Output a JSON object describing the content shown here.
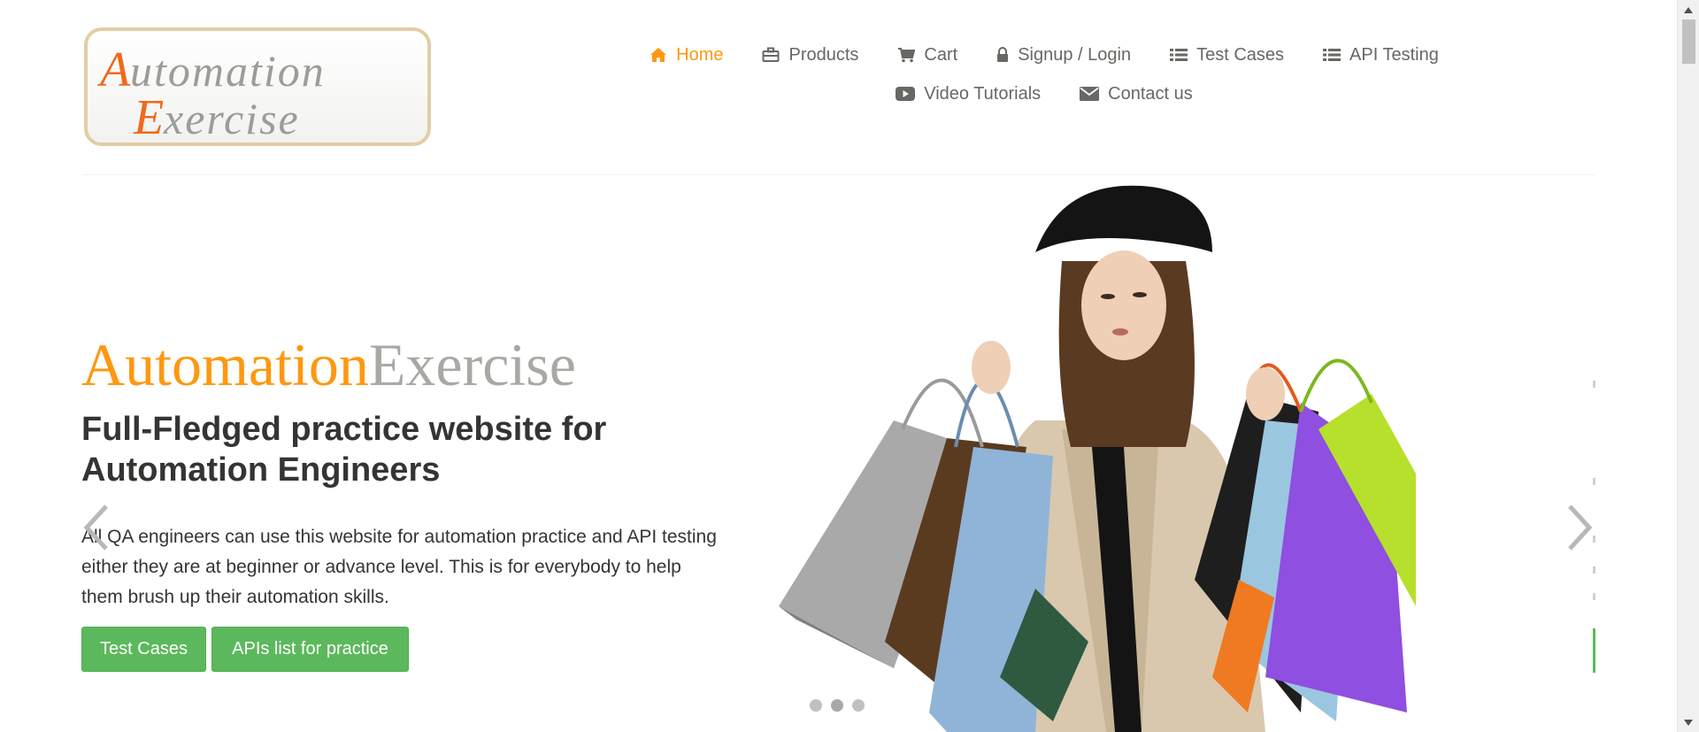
{
  "header": {
    "logo": {
      "line1": "Automation",
      "line2": "Exercise"
    },
    "nav": {
      "row1": [
        {
          "label": "Home",
          "icon": "home-icon",
          "active": true
        },
        {
          "label": "Products",
          "icon": "briefcase-icon",
          "active": false
        },
        {
          "label": "Cart",
          "icon": "cart-icon",
          "active": false
        },
        {
          "label": "Signup / Login",
          "icon": "lock-icon",
          "active": false
        },
        {
          "label": "Test Cases",
          "icon": "list-icon",
          "active": false
        },
        {
          "label": "API Testing",
          "icon": "list-icon",
          "active": false
        }
      ],
      "row2": [
        {
          "label": "Video Tutorials",
          "icon": "youtube-play-icon",
          "active": false
        },
        {
          "label": "Contact us",
          "icon": "envelope-icon",
          "active": false
        }
      ]
    }
  },
  "hero": {
    "brand_orange": "Automation",
    "brand_grey": "Exercise",
    "heading": "Full-Fledged practice website for Automation Engineers",
    "text": "All QA engineers can use this website for automation practice and API testing either they are at beginner or advance level. This is for everybody to help them brush up their automation skills.",
    "buttons": {
      "test_cases": "Test Cases",
      "apis": "APIs list for practice"
    },
    "carousel": {
      "slide_count": 3,
      "active_index": 1
    }
  },
  "colors": {
    "accent": "#fe980f",
    "nav_text": "#696763",
    "button_green": "#5cb85c",
    "brand_grey": "#a9a9a4"
  }
}
